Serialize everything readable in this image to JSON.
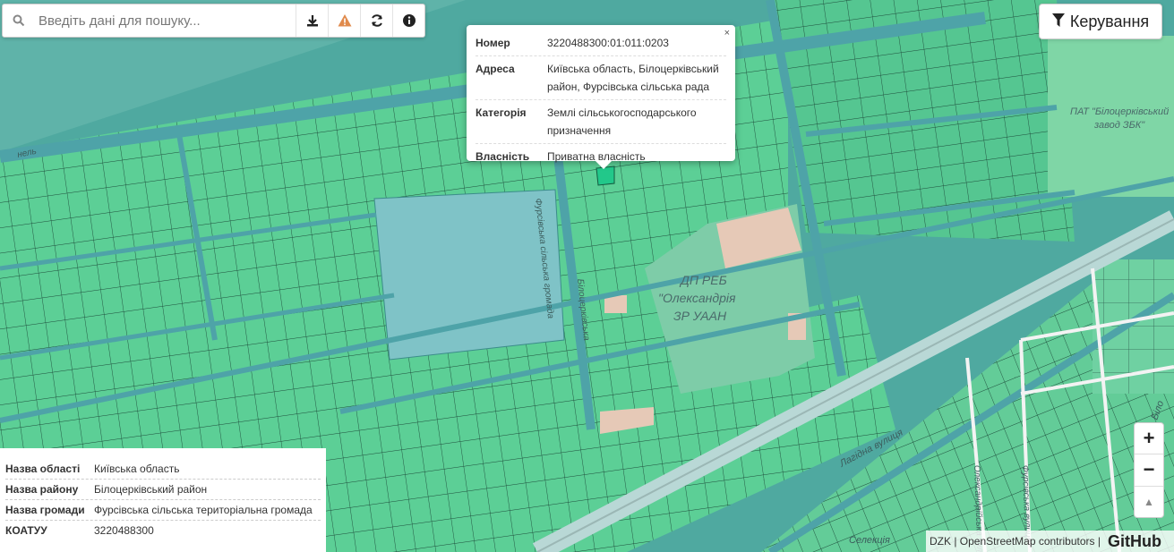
{
  "search": {
    "placeholder": "Введіть дані для пошуку..."
  },
  "toolbar": {
    "icons": [
      "download-icon",
      "warning-icon",
      "refresh-icon",
      "info-icon"
    ]
  },
  "control": {
    "label": "Керування"
  },
  "popup": {
    "close": "×",
    "rows": [
      {
        "key": "Номер",
        "value": "3220488300:01:011:0203"
      },
      {
        "key": "Адреса",
        "value": "Київська область, Білоцерківський район, Фурсівська сільська рада"
      },
      {
        "key": "Категорія",
        "value": "Землі сільськогосподарського призначення"
      },
      {
        "key": "Власність",
        "value": "Приватна власність"
      }
    ]
  },
  "info_panel": {
    "rows": [
      {
        "key": "Назва області",
        "value": "Київська область"
      },
      {
        "key": "Назва району",
        "value": "Білоцерківський район"
      },
      {
        "key": "Назва громади",
        "value": "Фурсівська сільська територіальна громада"
      },
      {
        "key": "КОАТУУ",
        "value": "3220488300"
      }
    ]
  },
  "zoom": {
    "in": "+",
    "out": "−",
    "north": "▲"
  },
  "attribution": {
    "text": "DZK | OpenStreetMap contributors |",
    "brand": "GitHub"
  },
  "map_labels": {
    "org": "ДП РЕБ \"Олександрія\" ЗР УААН",
    "plant": "ПАТ \"Білоцерківський завод ЗБК\"",
    "road_vert": "Фурсівська сільська громада",
    "road_vert2": "Білоцерківська",
    "street": "Лагідна вулиця",
    "street2": "Фурсівська вулиця",
    "street3": "Олександрійська вулиця",
    "tunnel": "нель",
    "village": "Селекція",
    "bilo": "Біло"
  },
  "colors": {
    "parcel": "#5ccf96",
    "parcel_dark": "#3fae7e",
    "road": "#4ea3a8",
    "water": "#7fc3c7",
    "selected": "#22c88a"
  }
}
